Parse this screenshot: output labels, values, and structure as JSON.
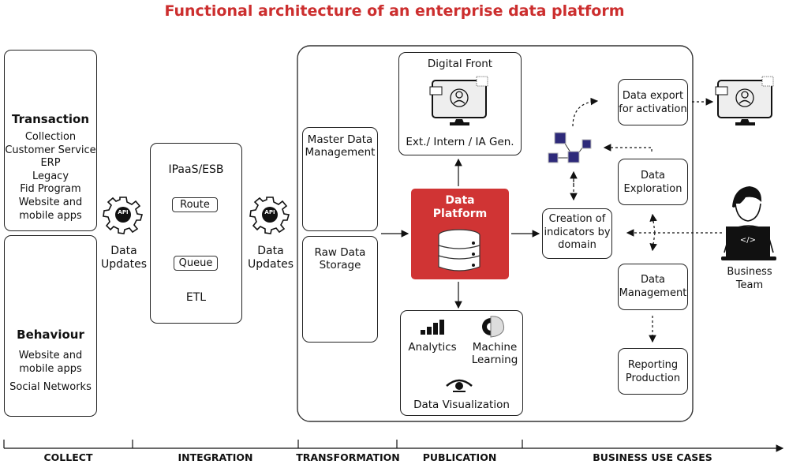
{
  "title": "Functional architecture of an enterprise data platform",
  "collect": {
    "transaction": {
      "heading": "Transaction",
      "items": [
        "Collection",
        "Customer Service",
        "ERP",
        "Legacy",
        "Fid Program",
        "Website and",
        "mobile apps"
      ]
    },
    "behaviour": {
      "heading": "Behaviour",
      "items": [
        "Website and",
        "mobile apps",
        "Social Networks"
      ]
    }
  },
  "api_left": {
    "icon_text": "API",
    "label_line1": "Data",
    "label_line2": "Updates"
  },
  "integration": {
    "title": "IPaaS/ESB",
    "route": "Route",
    "queue": "Queue",
    "etl": "ETL"
  },
  "api_right": {
    "icon_text": "API",
    "label_line1": "Data",
    "label_line2": "Updates"
  },
  "transformation": {
    "mdm_line1": "Master Data",
    "mdm_line2": "Management",
    "raw_line1": "Raw Data",
    "raw_line2": "Storage"
  },
  "publication": {
    "digital_front_title": "Digital Front",
    "digital_front_sub": "Ext./ Intern / IA Gen.",
    "platform_line1": "Data",
    "platform_line2": "Platform",
    "analytics": "Analytics",
    "ml_line1": "Machine",
    "ml_line2": "Learning",
    "dataviz": "Data Visualization"
  },
  "business": {
    "indicators": [
      "Creation of",
      "indicators by",
      "domain"
    ],
    "export": [
      "Data export",
      "for activation"
    ],
    "exploration": [
      "Data",
      "Exploration"
    ],
    "management": [
      "Data",
      "Management"
    ],
    "reporting": [
      "Reporting",
      "Production"
    ],
    "team": [
      "Business",
      "Team"
    ],
    "code_glyph": "</>"
  },
  "phases": [
    "COLLECT",
    "INTEGRATION",
    "TRANSFORMATION",
    "PUBLICATION",
    "BUSINESS USE CASES"
  ],
  "colors": {
    "accent": "#cc2e2e",
    "platform": "#d03434",
    "graph_node": "#2e2a7a"
  }
}
